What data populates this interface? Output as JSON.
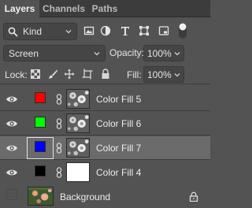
{
  "tabs": [
    {
      "label": "Layers",
      "active": true
    },
    {
      "label": "Channels",
      "active": false
    },
    {
      "label": "Paths",
      "active": false
    }
  ],
  "filter": {
    "kind_label": "Kind",
    "icons": [
      "pixel-layer-filter-icon",
      "adjustment-layer-filter-icon",
      "type-layer-filter-icon",
      "shape-layer-filter-icon",
      "smart-object-filter-icon",
      "filter-toggle-icon"
    ]
  },
  "blend": {
    "mode": "Screen",
    "opacity_label": "Opacity:",
    "opacity_value": "100%"
  },
  "lock": {
    "label": "Lock:",
    "icons": [
      "lock-transparent-pixels-icon",
      "lock-image-pixels-icon",
      "lock-position-icon",
      "lock-artboard-icon",
      "lock-all-icon"
    ],
    "fill_label": "Fill:",
    "fill_value": "100%"
  },
  "layers": [
    {
      "name": "Color Fill 5",
      "color": "#ff0000",
      "visible": true,
      "selected": false,
      "mask": "flower"
    },
    {
      "name": "Color Fill 6",
      "color": "#00ff00",
      "visible": true,
      "selected": false,
      "mask": "flower"
    },
    {
      "name": "Color Fill 7",
      "color": "#0000ff",
      "visible": true,
      "selected": true,
      "mask": "flower"
    },
    {
      "name": "Color Fill 4",
      "color": "#000000",
      "visible": true,
      "selected": false,
      "mask": "white"
    }
  ],
  "background": {
    "name": "Background",
    "visible": false,
    "locked": true
  },
  "colors": {
    "panel_bg": "#535353",
    "selected_row": "#6b6b6b",
    "tab_bar": "#3c3c3c"
  }
}
